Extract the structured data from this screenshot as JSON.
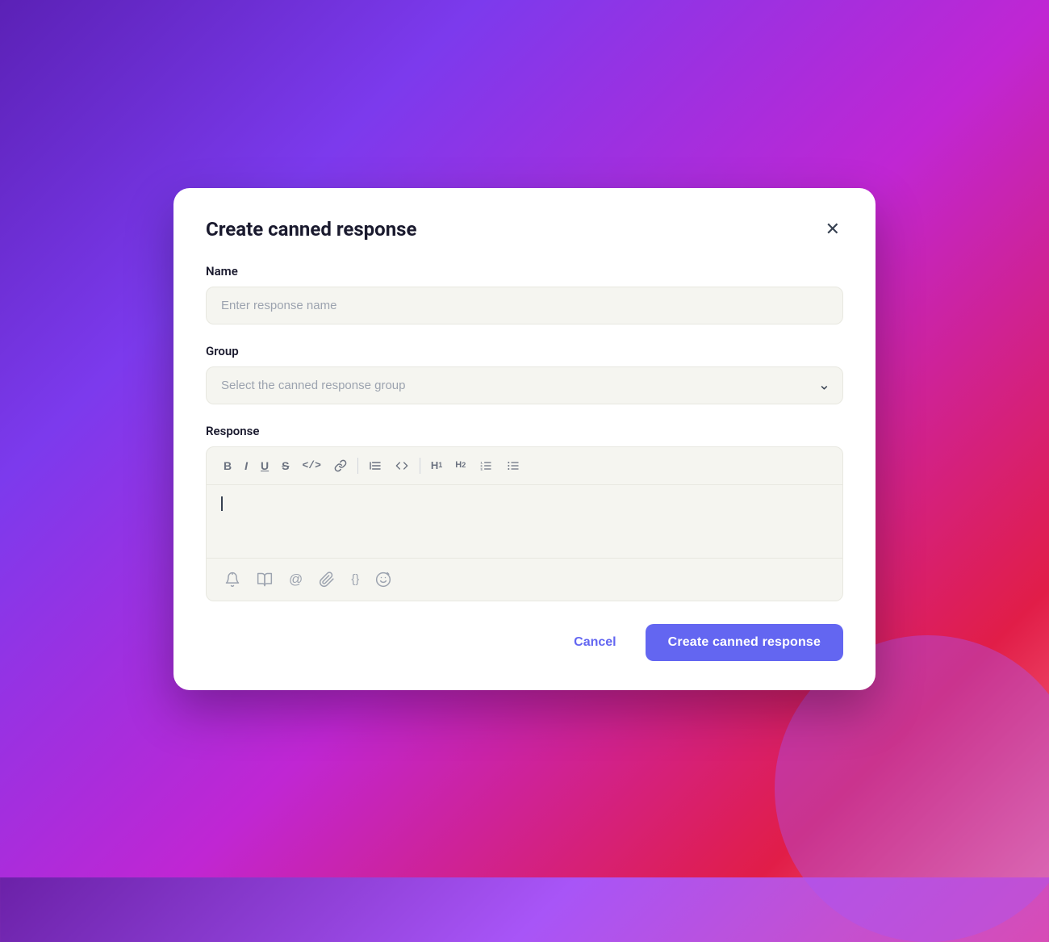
{
  "modal": {
    "title": "Create canned response",
    "close_label": "✕"
  },
  "name_field": {
    "label": "Name",
    "placeholder": "Enter response name",
    "value": ""
  },
  "group_field": {
    "label": "Group",
    "placeholder": "Select the canned response group",
    "options": []
  },
  "response_field": {
    "label": "Response"
  },
  "toolbar": {
    "bold": "B",
    "italic": "I",
    "underline": "U",
    "strikethrough": "S",
    "code": "</>",
    "link": "🔗",
    "blockquote": "|≡",
    "code_block": "{↵}",
    "h1": "H1",
    "h2": "H2",
    "ordered_list": "≡1",
    "unordered_list": "≡"
  },
  "bottom_toolbar": {
    "audio": "🔔",
    "book": "📖",
    "mention": "@",
    "attach": "📎",
    "variable": "{}",
    "emoji": "😊"
  },
  "footer": {
    "cancel_label": "Cancel",
    "create_label": "Create canned response"
  }
}
